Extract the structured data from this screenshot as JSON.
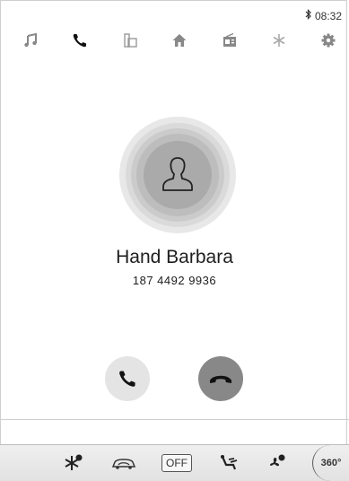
{
  "status_bar": {
    "time": "08:32",
    "bluetooth_icon": "bluetooth-icon"
  },
  "top_nav": {
    "items": [
      {
        "name": "music",
        "icon": "music-note-icon",
        "active": false
      },
      {
        "name": "phone",
        "icon": "phone-icon",
        "active": true
      },
      {
        "name": "media",
        "icon": "media-folder-icon",
        "active": false
      },
      {
        "name": "home",
        "icon": "home-icon",
        "active": false
      },
      {
        "name": "radio",
        "icon": "radio-icon",
        "active": false
      },
      {
        "name": "climate",
        "icon": "snowflake-icon",
        "active": false
      },
      {
        "name": "settings",
        "icon": "gear-icon",
        "active": false
      }
    ]
  },
  "caller": {
    "name": "Hand Barbara",
    "number": "187 4492 9936"
  },
  "actions": {
    "answer_icon": "phone-answer-icon",
    "hangup_icon": "phone-hangup-icon"
  },
  "climate_bar": {
    "off_label": "OFF",
    "view_label": "360°",
    "icons": [
      "ac-snowflake-icon",
      "car-recirculation-icon",
      "off-button",
      "seat-airflow-icon",
      "fan-icon",
      "360-view-icon"
    ]
  },
  "colors": {
    "background": "#ffffff",
    "ring_dark": "#aaaaaa",
    "hangup": "#888888",
    "answer": "#e4e4e4"
  }
}
